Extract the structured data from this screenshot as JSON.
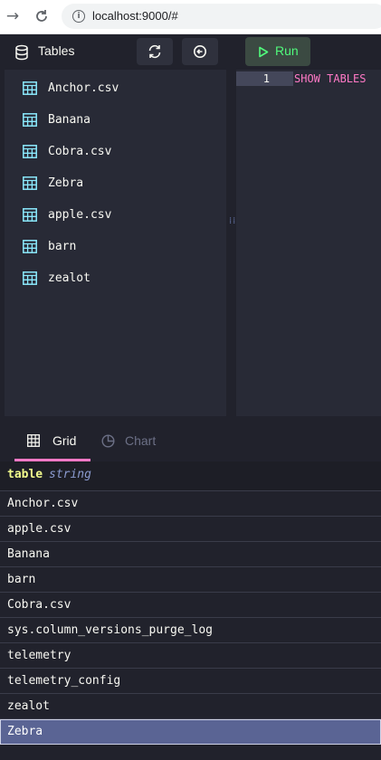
{
  "browser": {
    "url": "localhost:9000/#"
  },
  "toolbar": {
    "title": "Tables",
    "run_label": "Run"
  },
  "tables": [
    {
      "name": "Anchor.csv"
    },
    {
      "name": "Banana"
    },
    {
      "name": "Cobra.csv"
    },
    {
      "name": "Zebra"
    },
    {
      "name": "apple.csv"
    },
    {
      "name": "barn"
    },
    {
      "name": "zealot"
    }
  ],
  "editor": {
    "line_number": "1",
    "code": "SHOW TABLES"
  },
  "result_tabs": {
    "grid": "Grid",
    "chart": "Chart",
    "active": "Grid"
  },
  "results": {
    "column": {
      "name": "table",
      "type": "string"
    },
    "rows": [
      "Anchor.csv",
      "apple.csv",
      "Banana",
      "barn",
      "Cobra.csv",
      "sys.column_versions_purge_log",
      "telemetry",
      "telemetry_config",
      "zealot",
      "Zebra"
    ],
    "selected_row": "Zebra"
  },
  "colors": {
    "accent_pink": "#ff79c6",
    "run_green": "#50fa7b",
    "table_icon": "#8be9fd",
    "selected_row": "#5a6494"
  },
  "icons": {
    "database": "database-icon",
    "refresh": "refresh-icon",
    "history": "history-icon",
    "play": "play-icon",
    "table": "table-icon",
    "grid": "grid-icon",
    "chart": "pie-chart-icon"
  }
}
